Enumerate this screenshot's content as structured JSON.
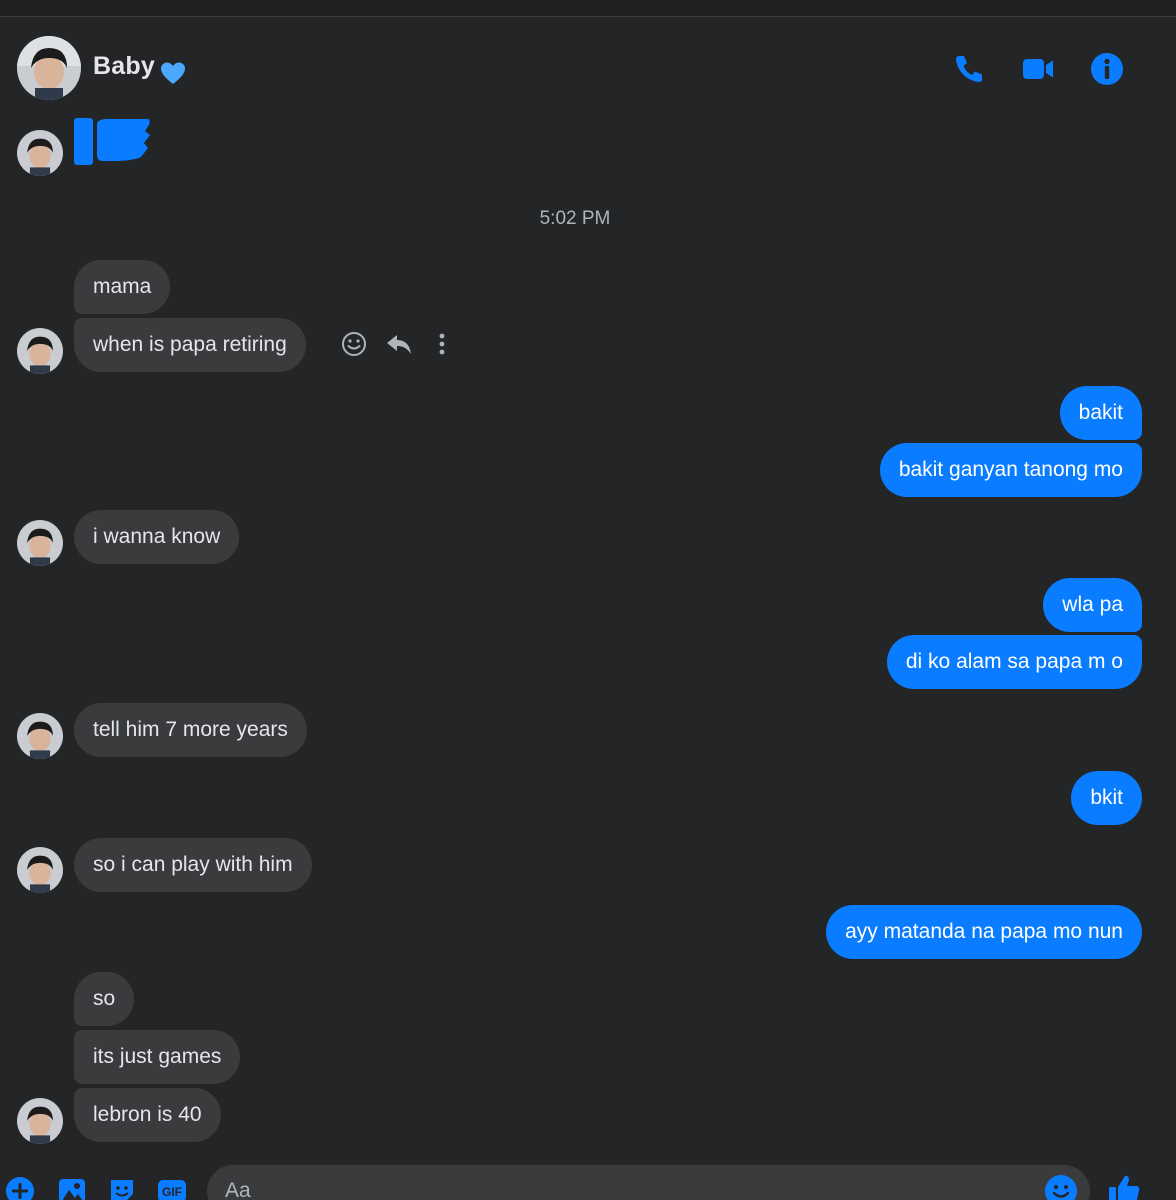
{
  "header": {
    "name": "Baby",
    "heart_emoji": "💙"
  },
  "timestamp": "5:02 PM",
  "messages": {
    "m1": "mama",
    "m2": "when is papa retiring",
    "m3": "bakit",
    "m4": "bakit ganyan tanong mo",
    "m5": "i wanna know",
    "m6": "wla pa",
    "m7": "di ko alam sa papa m o",
    "m8": "tell him 7 more years",
    "m9": "bkit",
    "m10": "so i can play with him",
    "m11": "ayy matanda na papa mo nun",
    "m12": "so",
    "m13": "its just games",
    "m14": "lebron is 40"
  },
  "composer": {
    "placeholder": "Aa"
  },
  "colors": {
    "background": "#242526",
    "incoming_bubble": "#3a3b3c",
    "outgoing_bubble": "#0a7cff",
    "accent": "#0a7cff"
  },
  "icons": [
    "phone-icon",
    "video-camera-icon",
    "info-icon",
    "smiley-icon",
    "reply-icon",
    "more-icon",
    "plus-icon",
    "image-icon",
    "sticker-icon",
    "gif-icon",
    "emoji-icon",
    "thumbs-up-icon"
  ]
}
